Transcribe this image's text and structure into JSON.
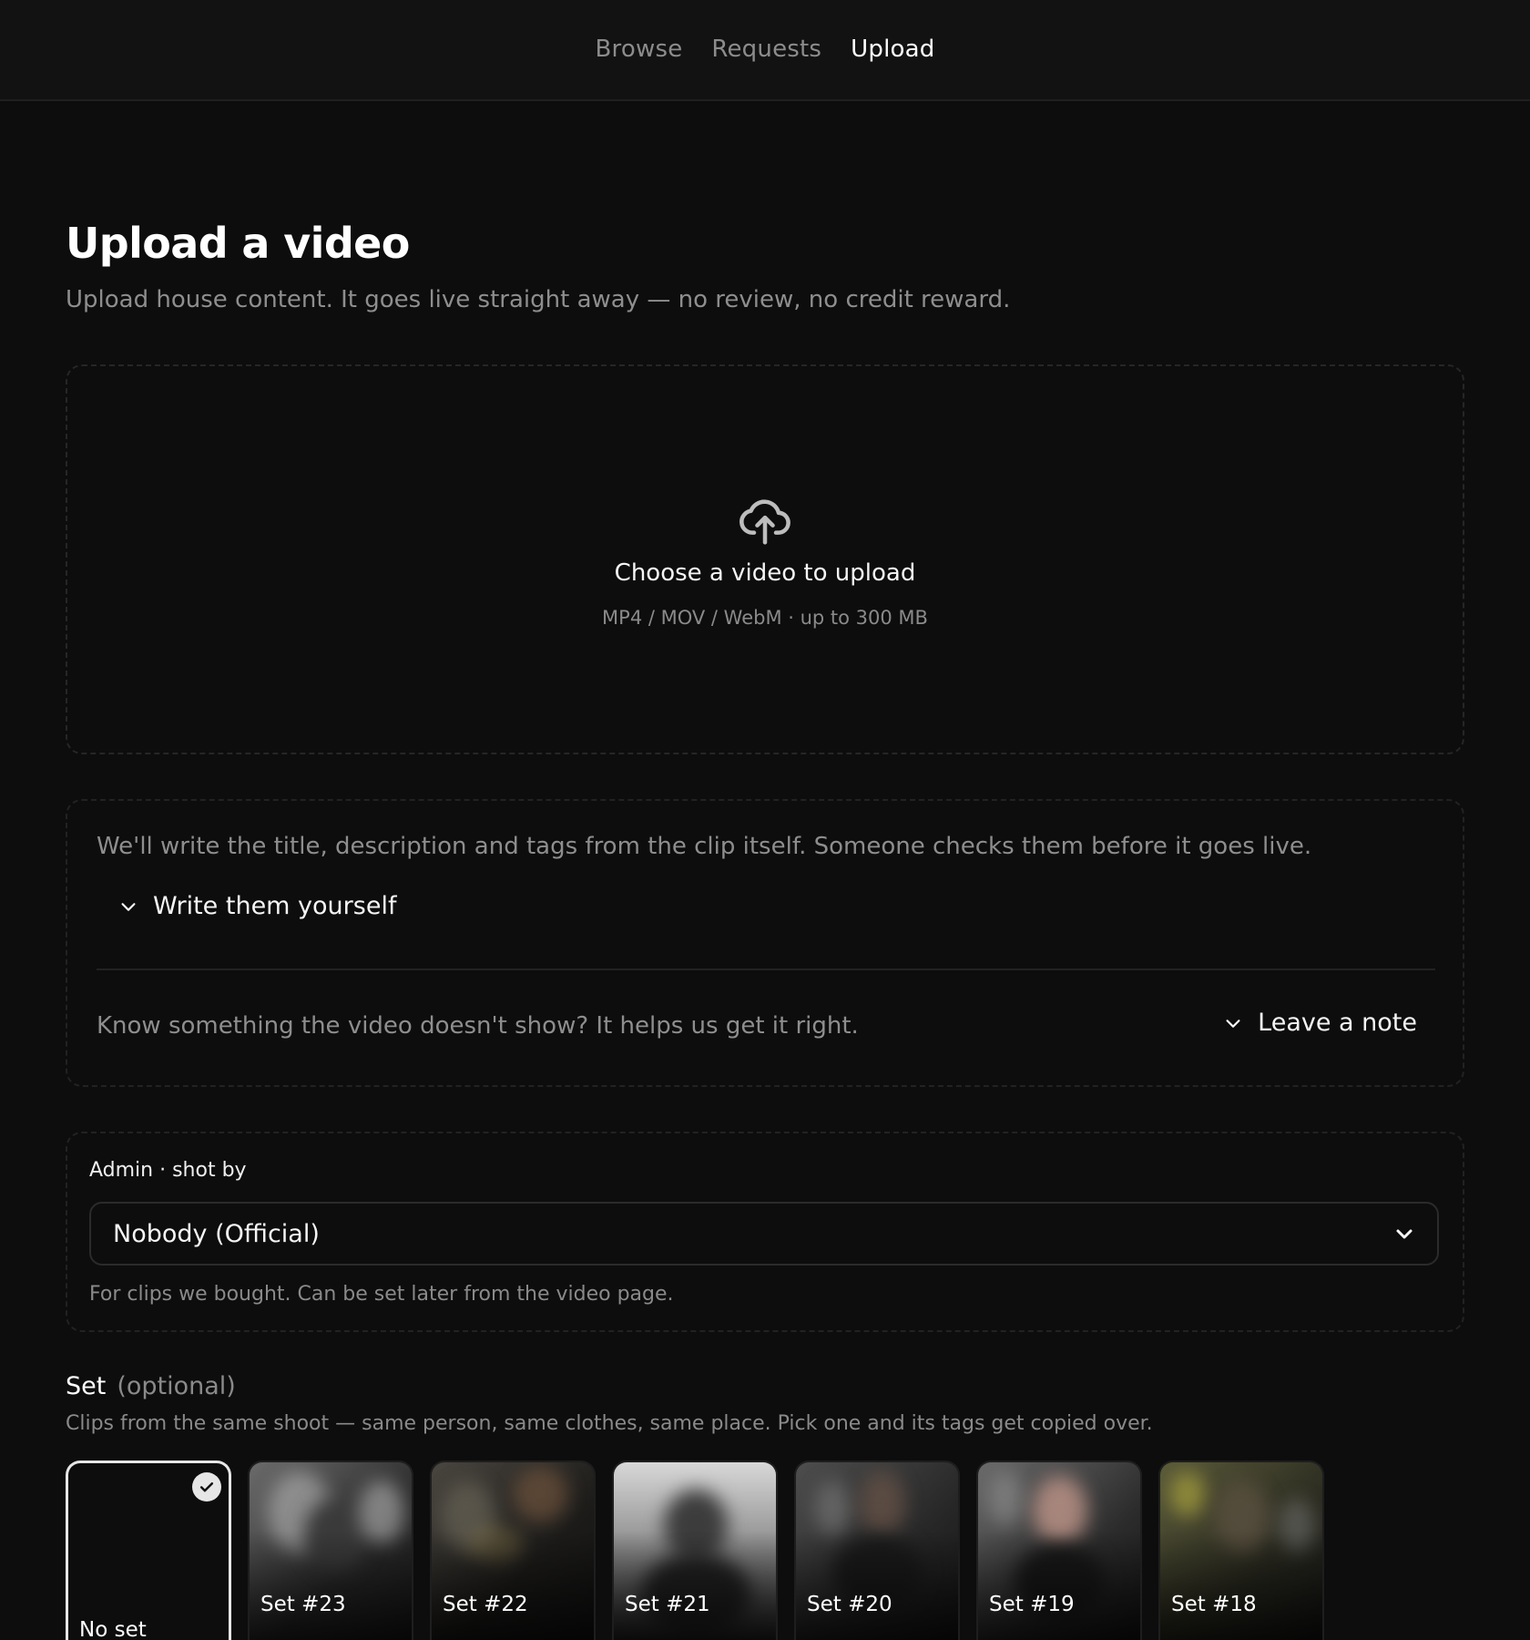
{
  "nav": {
    "items": [
      {
        "label": "Browse",
        "active": false
      },
      {
        "label": "Requests",
        "active": false
      },
      {
        "label": "Upload",
        "active": true
      }
    ]
  },
  "page": {
    "title": "Upload a video",
    "subtitle": "Upload house content. It goes live straight away — no review, no credit reward."
  },
  "dropzone": {
    "icon": "cloud-upload-icon",
    "title": "Choose a video to upload",
    "hint": "MP4 / MOV / WebM · up to 300 MB"
  },
  "metadata": {
    "intro": "We'll write the title, description and tags from the clip itself. Someone checks them before it goes live.",
    "write_toggle_label": "Write them yourself",
    "note_prompt": "Know something the video doesn't show? It helps us get it right.",
    "note_toggle_label": "Leave a note"
  },
  "admin": {
    "label": "Admin · shot by",
    "selected": "Nobody (Official)",
    "help": "For clips we bought. Can be set later from the video page."
  },
  "sets": {
    "heading": "Set",
    "optional": "(optional)",
    "description": "Clips from the same shoot — same person, same clothes, same place. Pick one and its tags get copied over.",
    "items": [
      {
        "label": "No set",
        "selected": true
      },
      {
        "label": "Set #23",
        "selected": false
      },
      {
        "label": "Set #22",
        "selected": false
      },
      {
        "label": "Set #21",
        "selected": false
      },
      {
        "label": "Set #20",
        "selected": false
      },
      {
        "label": "Set #19",
        "selected": false
      },
      {
        "label": "Set #18",
        "selected": false
      }
    ]
  },
  "colors": {
    "background": "#0d0d0d",
    "nav_background": "#121212",
    "text_primary": "#ffffff",
    "text_muted": "#8e8e8e",
    "border": "#222222"
  }
}
